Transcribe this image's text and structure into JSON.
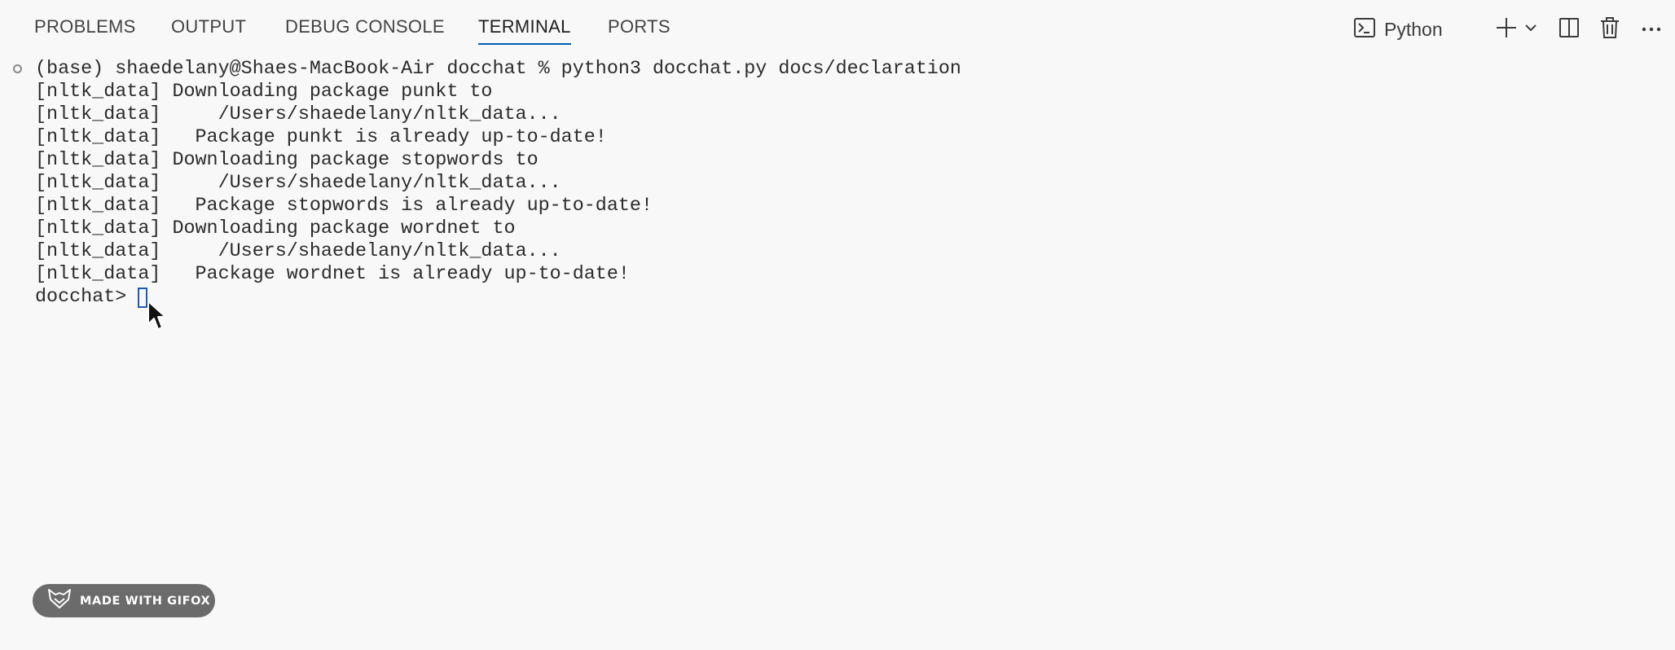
{
  "tabs": [
    {
      "label": "PROBLEMS",
      "active": false
    },
    {
      "label": "OUTPUT",
      "active": false
    },
    {
      "label": "DEBUG CONSOLE",
      "active": false
    },
    {
      "label": "TERMINAL",
      "active": true
    },
    {
      "label": "PORTS",
      "active": false
    }
  ],
  "toolbar": {
    "profile_icon": "terminal-icon",
    "profile_label": "Python",
    "new_terminal_icon": "plus-icon",
    "dropdown_icon": "chevron-down-icon",
    "split_icon": "split-terminal-icon",
    "kill_icon": "trash-icon",
    "more_icon": "ellipsis-icon"
  },
  "terminal": {
    "lines": [
      "(base) shaedelany@Shaes-MacBook-Air docchat % python3 docchat.py docs/declaration",
      "[nltk_data] Downloading package punkt to",
      "[nltk_data]     /Users/shaedelany/nltk_data...",
      "[nltk_data]   Package punkt is already up-to-date!",
      "[nltk_data] Downloading package stopwords to",
      "[nltk_data]     /Users/shaedelany/nltk_data...",
      "[nltk_data]   Package stopwords is already up-to-date!",
      "[nltk_data] Downloading package wordnet to",
      "[nltk_data]     /Users/shaedelany/nltk_data...",
      "[nltk_data]   Package wordnet is already up-to-date!",
      "docchat> "
    ]
  },
  "watermark": {
    "label": "MADE WITH GIFOX",
    "icon": "fox-logo-icon"
  },
  "colors": {
    "background": "#f8f8f8",
    "accent": "#005fb8",
    "badge": "#6b6b6b"
  }
}
